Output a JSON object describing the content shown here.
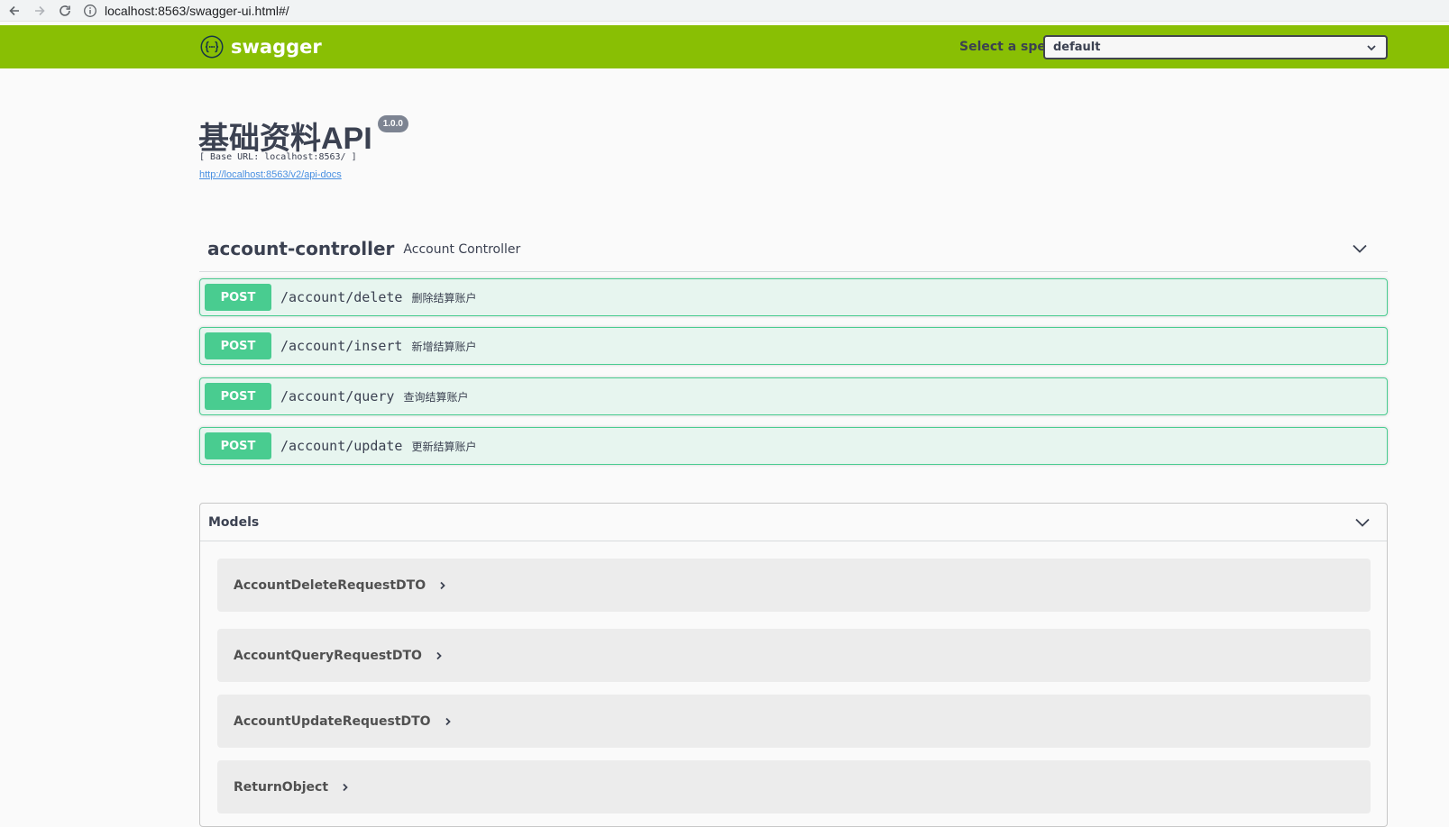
{
  "browser": {
    "url": "localhost:8563/swagger-ui.html#/"
  },
  "topbar": {
    "logo_text": "swagger",
    "spec_label": "Select a spec",
    "spec_value": "default"
  },
  "info": {
    "title": "基础资料API",
    "version": "1.0.0",
    "base_url": "[ Base URL: localhost:8563/ ]",
    "api_docs_link": "http://localhost:8563/v2/api-docs"
  },
  "controller": {
    "name": "account-controller",
    "description": "Account Controller",
    "operations": [
      {
        "method": "POST",
        "path": "/account/delete",
        "summary": "删除结算账户"
      },
      {
        "method": "POST",
        "path": "/account/insert",
        "summary": "新增结算账户"
      },
      {
        "method": "POST",
        "path": "/account/query",
        "summary": "查询结算账户"
      },
      {
        "method": "POST",
        "path": "/account/update",
        "summary": "更新结算账户"
      }
    ]
  },
  "models": {
    "title": "Models",
    "items": [
      "AccountDeleteRequestDTO",
      "AccountQueryRequestDTO",
      "AccountUpdateRequestDTO",
      "ReturnObject"
    ]
  },
  "colors": {
    "topbar": "#89bf04",
    "post": "#49cc90",
    "text": "#3b4151"
  }
}
